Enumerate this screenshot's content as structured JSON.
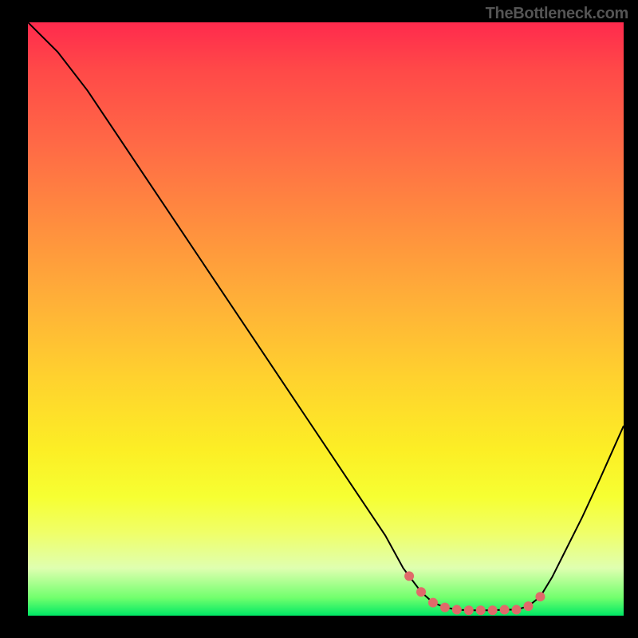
{
  "watermark": "TheBottleneck.com",
  "chart_data": {
    "type": "line",
    "title": "",
    "xlabel": "",
    "ylabel": "",
    "xlim": [
      0,
      100
    ],
    "ylim": [
      0,
      100
    ],
    "curve_xy": [
      [
        0,
        100
      ],
      [
        5,
        95
      ],
      [
        10,
        88.5
      ],
      [
        15,
        81
      ],
      [
        20,
        73.5
      ],
      [
        25,
        66
      ],
      [
        30,
        58.5
      ],
      [
        35,
        51
      ],
      [
        40,
        43.5
      ],
      [
        45,
        36
      ],
      [
        50,
        28.5
      ],
      [
        55,
        21
      ],
      [
        60,
        13.5
      ],
      [
        63,
        8
      ],
      [
        66,
        4
      ],
      [
        68,
        2.2
      ],
      [
        70,
        1.4
      ],
      [
        72,
        1.0
      ],
      [
        74,
        0.9
      ],
      [
        76,
        0.9
      ],
      [
        78,
        0.9
      ],
      [
        80,
        1.0
      ],
      [
        82,
        1.0
      ],
      [
        84,
        1.6
      ],
      [
        86,
        3.2
      ],
      [
        88,
        6.5
      ],
      [
        90,
        10.5
      ],
      [
        93,
        16.5
      ],
      [
        96,
        23
      ],
      [
        100,
        32
      ]
    ],
    "marker_xs": [
      64,
      66,
      68,
      70,
      72,
      74,
      76,
      78,
      80,
      82,
      84,
      86
    ],
    "marker_color": "#e06a6a",
    "gradient_stops": [
      {
        "pos": 0.0,
        "color": "#ff2a4d"
      },
      {
        "pos": 0.08,
        "color": "#ff4948"
      },
      {
        "pos": 0.2,
        "color": "#ff6846"
      },
      {
        "pos": 0.33,
        "color": "#ff8b3f"
      },
      {
        "pos": 0.47,
        "color": "#ffb038"
      },
      {
        "pos": 0.6,
        "color": "#ffd22e"
      },
      {
        "pos": 0.72,
        "color": "#fcee25"
      },
      {
        "pos": 0.8,
        "color": "#f6ff32"
      },
      {
        "pos": 0.86,
        "color": "#f0ff68"
      },
      {
        "pos": 0.92,
        "color": "#dfffb0"
      },
      {
        "pos": 0.97,
        "color": "#71ff6d"
      },
      {
        "pos": 1.0,
        "color": "#00e865"
      }
    ]
  }
}
